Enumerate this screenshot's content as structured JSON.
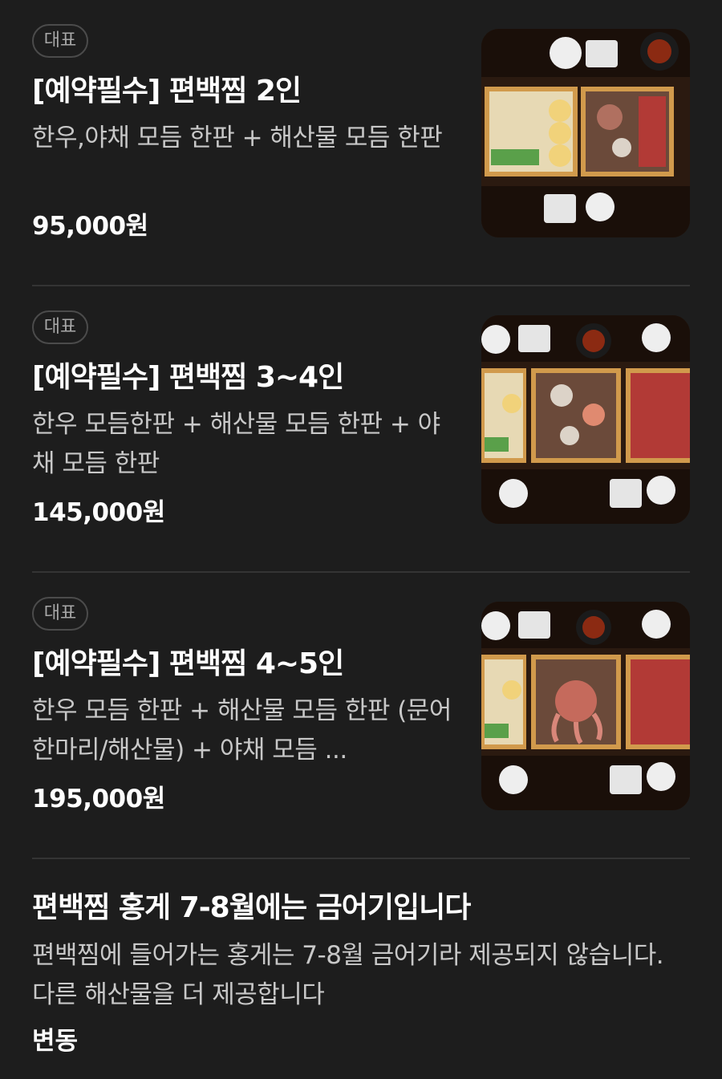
{
  "menu": {
    "items": [
      {
        "badge": "대표",
        "title": "[예약필수] 편백찜 2인",
        "description": "한우,야채 모듬 한판 + 해산물 모듬 한판",
        "price": "95,000원",
        "image_icon": "food-photo-2-person-set"
      },
      {
        "badge": "대표",
        "title": "[예약필수] 편백찜 3~4인",
        "description": "한우 모듬한판 + 해산물 모듬 한판 + 야채 모듬 한판",
        "price": "145,000원",
        "image_icon": "food-photo-3-4-person-set"
      },
      {
        "badge": "대표",
        "title": "[예약필수] 편백찜 4~5인",
        "description": "한우 모듬 한판 + 해산물 모듬 한판 (문어 한마리/해산물) + 야채 모듬 ...",
        "price": "195,000원",
        "image_icon": "food-photo-4-5-person-set"
      }
    ]
  },
  "notice": {
    "title": "편백찜 홍게 7-8월에는 금어기입니다",
    "body": "편백찜에 들어가는 홍게는 7-8월 금어기라 제공되지 않습니다. 다른 해산물을 더 제공합니다",
    "tag": "변동"
  },
  "colors": {
    "background": "#1d1d1d",
    "divider": "#343434",
    "text_primary": "#ffffff",
    "text_secondary": "#c8c8c8",
    "badge_border": "#4b4b4b",
    "badge_text": "#a8a8a8"
  }
}
